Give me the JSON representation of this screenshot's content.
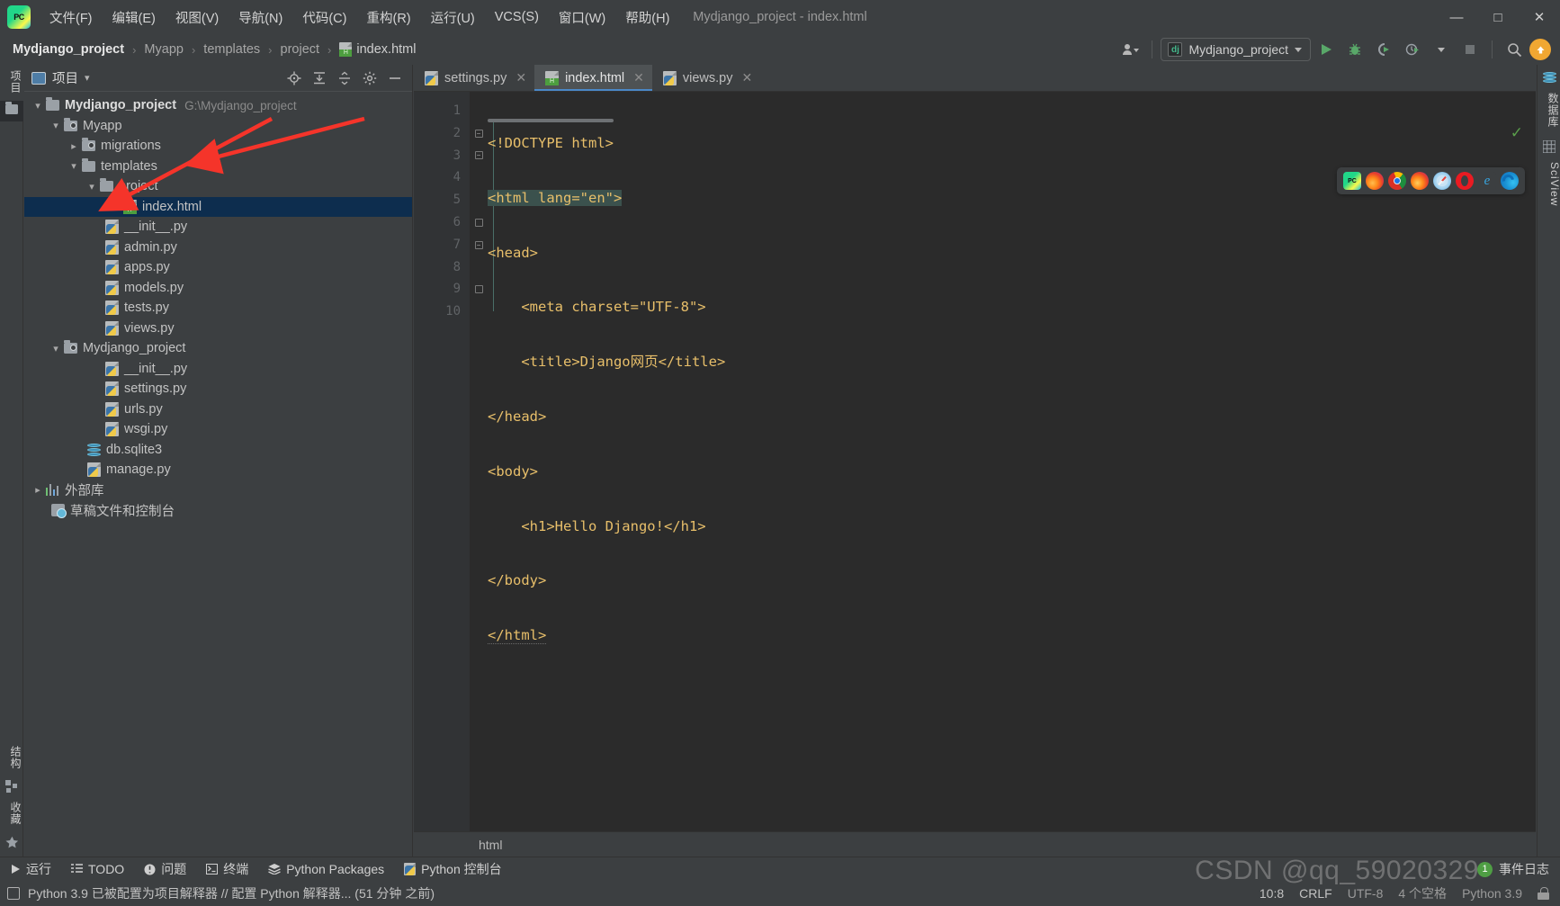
{
  "window": {
    "title": "Mydjango_project - index.html",
    "logo_text": "PC",
    "minimize": "—",
    "maximize": "□",
    "close": "✕"
  },
  "menubar": {
    "items": [
      {
        "label": "文件(F)"
      },
      {
        "label": "编辑(E)"
      },
      {
        "label": "视图(V)"
      },
      {
        "label": "导航(N)"
      },
      {
        "label": "代码(C)"
      },
      {
        "label": "重构(R)"
      },
      {
        "label": "运行(U)"
      },
      {
        "label": "VCS(S)"
      },
      {
        "label": "窗口(W)"
      },
      {
        "label": "帮助(H)"
      }
    ]
  },
  "breadcrumb": {
    "sep": "›",
    "items": [
      "Mydjango_project",
      "Myapp",
      "templates",
      "project",
      "index.html"
    ]
  },
  "toolbar": {
    "run_config": "Mydjango_project",
    "run_config_icon": "dj",
    "run_label": "▶",
    "debug_label": "🐞",
    "coverage_label": "▶",
    "profile_label": "⏱",
    "stop_label": "■",
    "search_label": "⌕",
    "update_label": "↑",
    "users_label": "👤"
  },
  "left_rail": {
    "top_tab": "项目",
    "items": [
      "结构",
      "收藏"
    ]
  },
  "right_rail": {
    "items": [
      "数据库",
      "SciView"
    ]
  },
  "project_panel": {
    "title": "项目",
    "dropdown": "▾",
    "actions": [
      "locate-icon",
      "expand-all-icon",
      "collapse-all-icon",
      "settings-icon",
      "hide-icon"
    ],
    "tree": [
      {
        "label": "Mydjango_project",
        "sub": "G:\\Mydjango_project",
        "icon": "folder",
        "indent": 0,
        "arrow": "down",
        "bold": true,
        "selected": false
      },
      {
        "label": "Myapp",
        "sub": "",
        "icon": "folder-module",
        "indent": 1,
        "arrow": "down",
        "bold": false,
        "selected": false
      },
      {
        "label": "migrations",
        "sub": "",
        "icon": "folder-module",
        "indent": 2,
        "arrow": "right",
        "bold": false,
        "selected": false
      },
      {
        "label": "templates",
        "sub": "",
        "icon": "folder",
        "indent": 2,
        "arrow": "down",
        "bold": false,
        "selected": false
      },
      {
        "label": "project",
        "sub": "",
        "icon": "folder",
        "indent": 3,
        "arrow": "down",
        "bold": false,
        "selected": false
      },
      {
        "label": "index.html",
        "sub": "",
        "icon": "html",
        "indent": 4,
        "arrow": "",
        "bold": false,
        "selected": true
      },
      {
        "label": "__init__.py",
        "sub": "",
        "icon": "py",
        "indent": 3,
        "arrow": "",
        "bold": false,
        "selected": false
      },
      {
        "label": "admin.py",
        "sub": "",
        "icon": "py",
        "indent": 3,
        "arrow": "",
        "bold": false,
        "selected": false
      },
      {
        "label": "apps.py",
        "sub": "",
        "icon": "py",
        "indent": 3,
        "arrow": "",
        "bold": false,
        "selected": false
      },
      {
        "label": "models.py",
        "sub": "",
        "icon": "py",
        "indent": 3,
        "arrow": "",
        "bold": false,
        "selected": false
      },
      {
        "label": "tests.py",
        "sub": "",
        "icon": "py",
        "indent": 3,
        "arrow": "",
        "bold": false,
        "selected": false
      },
      {
        "label": "views.py",
        "sub": "",
        "icon": "py",
        "indent": 3,
        "arrow": "",
        "bold": false,
        "selected": false
      },
      {
        "label": "Mydjango_project",
        "sub": "",
        "icon": "folder-module",
        "indent": 1,
        "arrow": "down",
        "bold": false,
        "selected": false
      },
      {
        "label": "__init__.py",
        "sub": "",
        "icon": "py",
        "indent": 3,
        "arrow": "",
        "bold": false,
        "selected": false
      },
      {
        "label": "settings.py",
        "sub": "",
        "icon": "py",
        "indent": 3,
        "arrow": "",
        "bold": false,
        "selected": false
      },
      {
        "label": "urls.py",
        "sub": "",
        "icon": "py",
        "indent": 3,
        "arrow": "",
        "bold": false,
        "selected": false
      },
      {
        "label": "wsgi.py",
        "sub": "",
        "icon": "py",
        "indent": 3,
        "arrow": "",
        "bold": false,
        "selected": false
      },
      {
        "label": "db.sqlite3",
        "sub": "",
        "icon": "db",
        "indent": 2,
        "arrow": "",
        "bold": false,
        "selected": false
      },
      {
        "label": "manage.py",
        "sub": "",
        "icon": "py",
        "indent": 2,
        "arrow": "",
        "bold": false,
        "selected": false
      },
      {
        "label": "外部库",
        "sub": "",
        "icon": "lib",
        "indent": 0,
        "arrow": "right",
        "bold": false,
        "selected": false
      },
      {
        "label": "草稿文件和控制台",
        "sub": "",
        "icon": "scratch",
        "indent": 1,
        "arrow": "",
        "bold": false,
        "selected": false
      }
    ]
  },
  "editor": {
    "tabs": [
      {
        "label": "settings.py",
        "icon": "py",
        "active": false,
        "close": "✕"
      },
      {
        "label": "index.html",
        "icon": "html",
        "active": true,
        "close": "✕"
      },
      {
        "label": "views.py",
        "icon": "py",
        "active": false,
        "close": "✕"
      }
    ],
    "line_numbers": [
      "1",
      "2",
      "3",
      "4",
      "5",
      "6",
      "7",
      "8",
      "9",
      "10"
    ],
    "code_lines": [
      "<!DOCTYPE html>",
      "<html lang=\"en\">",
      "<head>",
      "    <meta charset=\"UTF-8\">",
      "    <title>Django网页</title>",
      "</head>",
      "<body>",
      "    <h1>Hello Django!</h1>",
      "</body>",
      "</html>"
    ],
    "footer_breadcrumb": "html",
    "inspection_status": "✓"
  },
  "browser_bar": {
    "icons": [
      "pycharm-icon",
      "firefox-icon",
      "chrome-icon",
      "firefox-developer-icon",
      "safari-icon",
      "opera-icon",
      "internet-explorer-icon",
      "edge-icon"
    ]
  },
  "toolwindows": {
    "items": [
      {
        "label": "运行",
        "icon": "run-icon"
      },
      {
        "label": "TODO",
        "icon": "todo-icon"
      },
      {
        "label": "问题",
        "icon": "problems-icon"
      },
      {
        "label": "终端",
        "icon": "terminal-icon"
      },
      {
        "label": "Python Packages",
        "icon": "packages-icon"
      },
      {
        "label": "Python 控制台",
        "icon": "python-console-icon"
      }
    ],
    "event_log": "事件日志",
    "event_log_count": "1"
  },
  "statusbar": {
    "message": "Python 3.9 已被配置为项目解释器 // 配置 Python 解释器... (51 分钟 之前)",
    "caret": "10:8",
    "line_sep": "CRLF",
    "encoding": "UTF-8",
    "indent": "4 个空格",
    "interpreter": "Python 3.9"
  },
  "watermark": {
    "text": "CSDN @qq_59020329"
  },
  "colors": {
    "bg": "#3c3f41",
    "editor_bg": "#2b2b2b",
    "selection": "#0d2d4e",
    "accent": "#4a88c7",
    "annotation_red": "#f5342a",
    "green": "#4f9e44"
  }
}
